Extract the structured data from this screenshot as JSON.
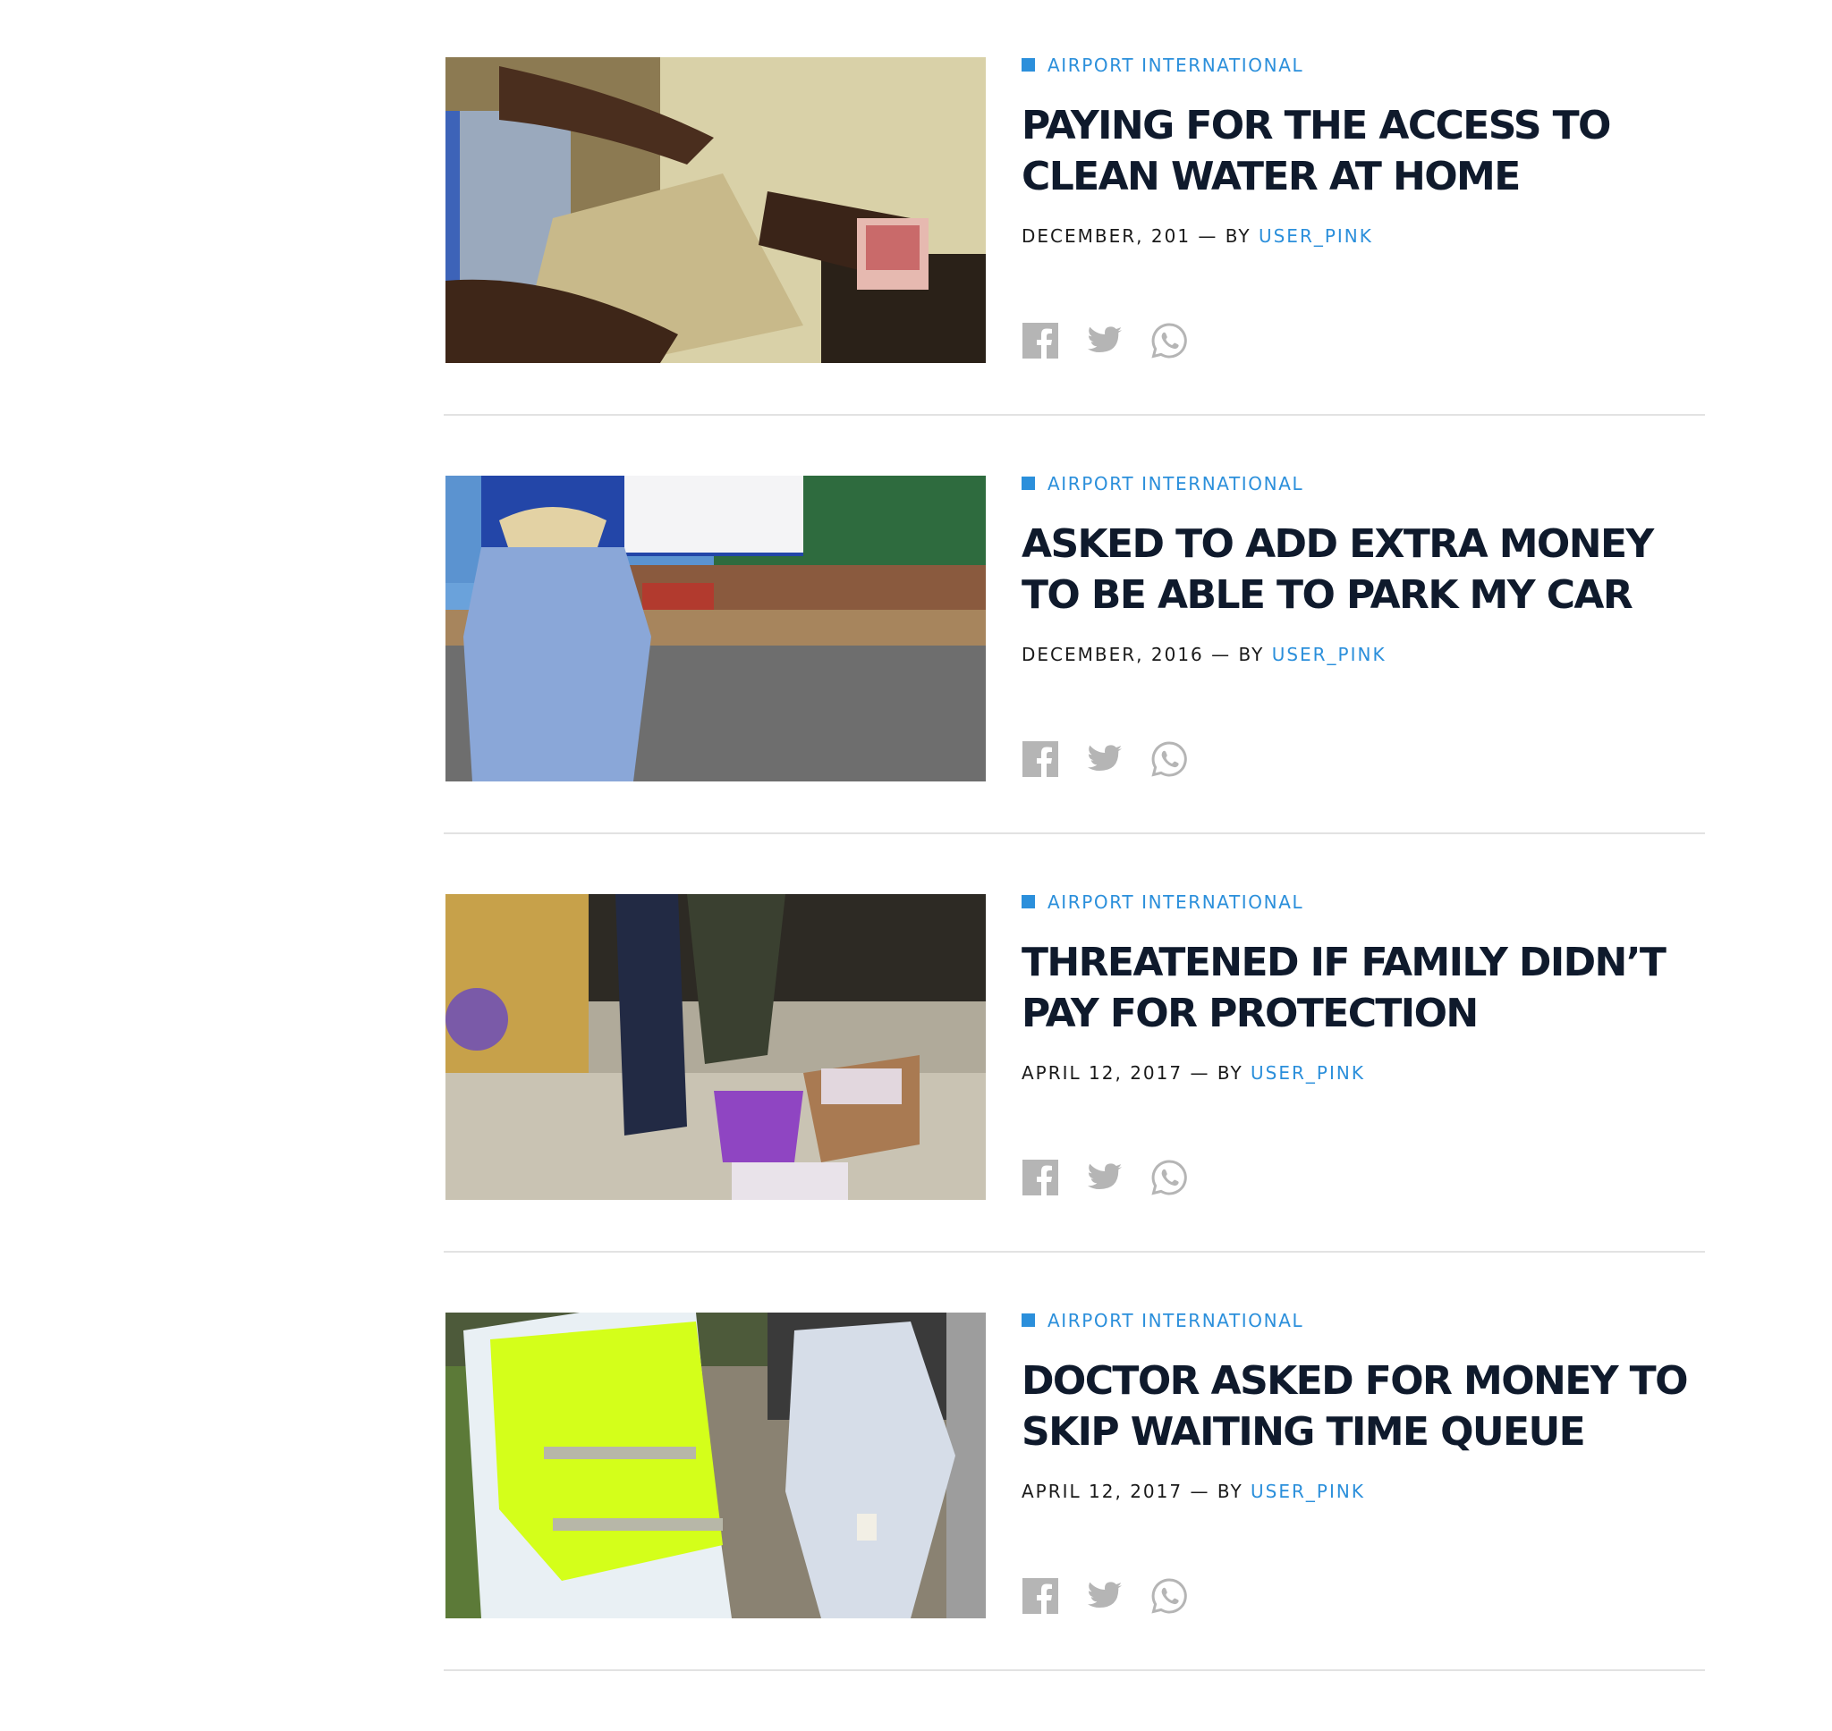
{
  "colors": {
    "accent": "#2b8fdb",
    "headline": "#0f1a2c",
    "share_icons": "#b5b5b5",
    "divider": "#e2e2e2"
  },
  "articles": [
    {
      "category": "AIRPORT INTERNATIONAL",
      "title": "PAYING FOR THE ACCESS TO CLEAN WATER AT HOME",
      "date": "DECEMBER, 201",
      "by": "— BY",
      "author": "USER_PINK",
      "share_icons": [
        "facebook-icon",
        "twitter-icon",
        "whatsapp-icon"
      ]
    },
    {
      "category": "AIRPORT INTERNATIONAL",
      "title": "ASKED TO ADD EXTRA MONEY TO BE ABLE TO PARK MY CAR",
      "date": "DECEMBER, 2016",
      "by": "— BY",
      "author": "USER_PINK",
      "share_icons": [
        "facebook-icon",
        "twitter-icon",
        "whatsapp-icon"
      ]
    },
    {
      "category": "AIRPORT INTERNATIONAL",
      "title": "THREATENED IF FAMILY DIDN’T PAY FOR PROTECTION",
      "date": "APRIL 12, 2017",
      "by": "— BY",
      "author": "USER_PINK",
      "share_icons": [
        "facebook-icon",
        "twitter-icon",
        "whatsapp-icon"
      ]
    },
    {
      "category": "AIRPORT INTERNATIONAL",
      "title": "DOCTOR ASKED FOR MONEY TO SKIP WAITING TIME QUEUE",
      "date": "APRIL 12, 2017",
      "by": "— BY",
      "author": "USER_PINK",
      "share_icons": [
        "facebook-icon",
        "twitter-icon",
        "whatsapp-icon"
      ]
    }
  ]
}
